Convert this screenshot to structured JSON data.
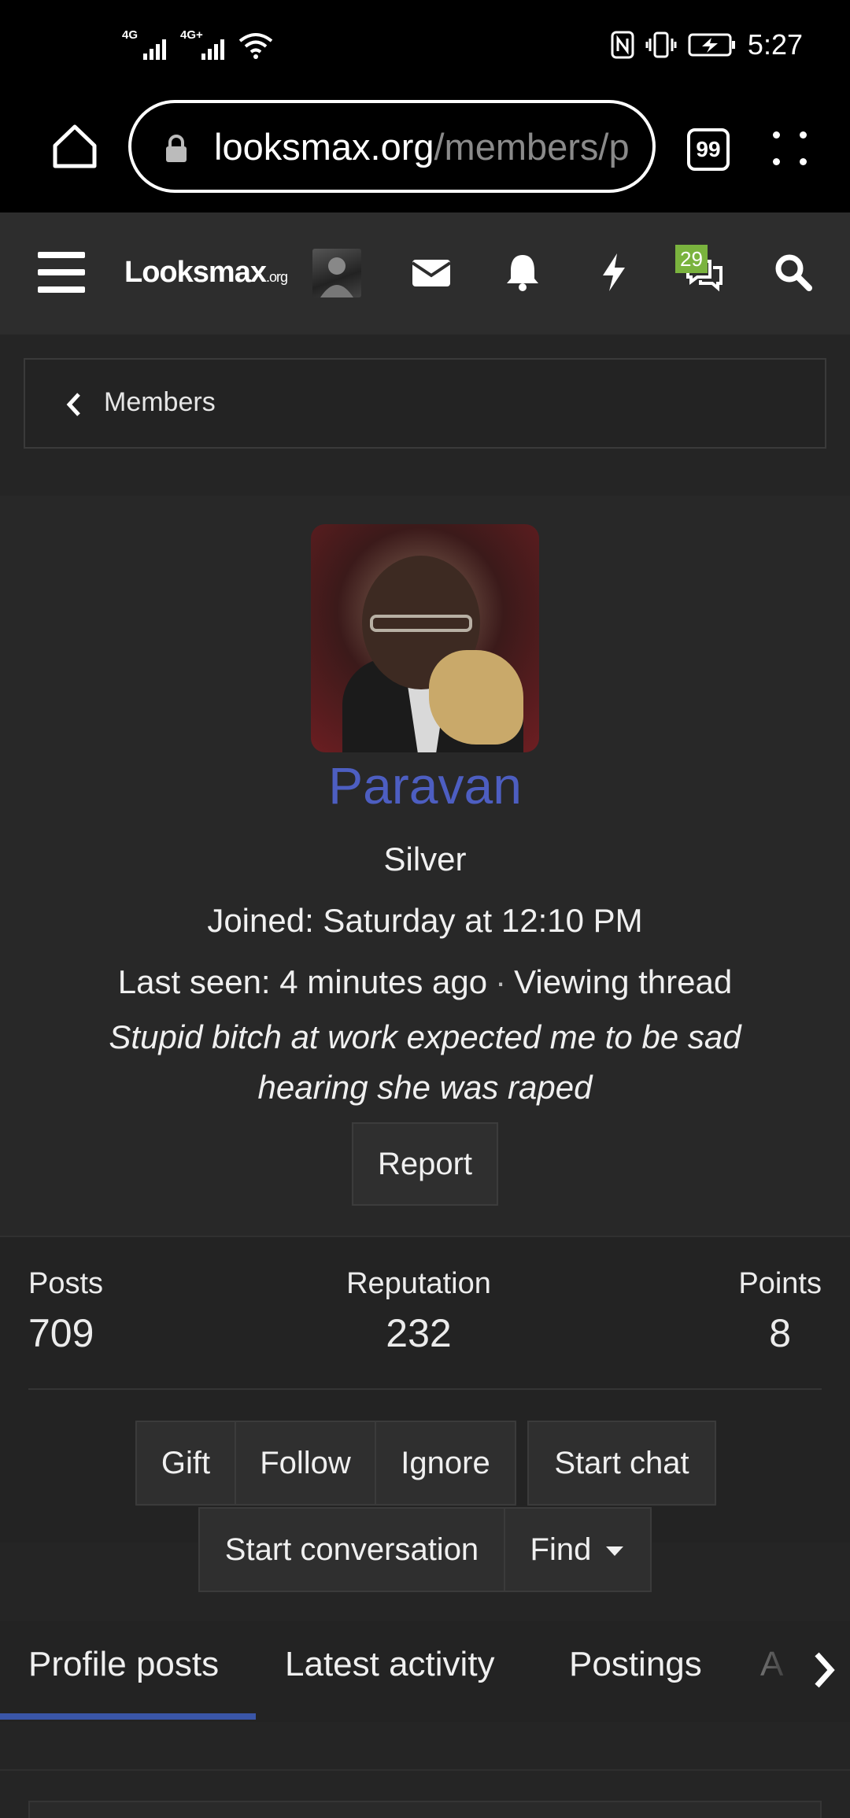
{
  "status_bar": {
    "network1": "4G",
    "network2": "4G+",
    "time": "5:27"
  },
  "browser": {
    "url_host": "looksmax.org",
    "url_path": "/members/p",
    "tab_count": "99"
  },
  "site_nav": {
    "logo_main": "Looksmax",
    "logo_suffix": ".org",
    "chat_badge": "29"
  },
  "breadcrumb": {
    "label": "Members"
  },
  "profile": {
    "username": "Paravan",
    "user_title": "Silver",
    "joined": "Joined: Saturday at 12:10 PM",
    "last_seen": "Last seen: 4 minutes ago",
    "activity": "Viewing thread",
    "status_message": "Stupid bitch at work expected me to be sad hearing she was raped",
    "report_label": "Report"
  },
  "stats": {
    "posts_label": "Posts",
    "posts_value": "709",
    "reputation_label": "Reputation",
    "reputation_value": "232",
    "points_label": "Points",
    "points_value": "8"
  },
  "actions": {
    "gift": "Gift",
    "follow": "Follow",
    "ignore": "Ignore",
    "start_chat": "Start chat",
    "start_conversation": "Start conversation",
    "find": "Find"
  },
  "tabs": {
    "profile_posts": "Profile posts",
    "latest_activity": "Latest activity",
    "postings": "Postings",
    "more": "A"
  },
  "colors": {
    "username": "#4d5ec1",
    "active_tab": "#3a56a8",
    "badge": "#7ab33e"
  }
}
